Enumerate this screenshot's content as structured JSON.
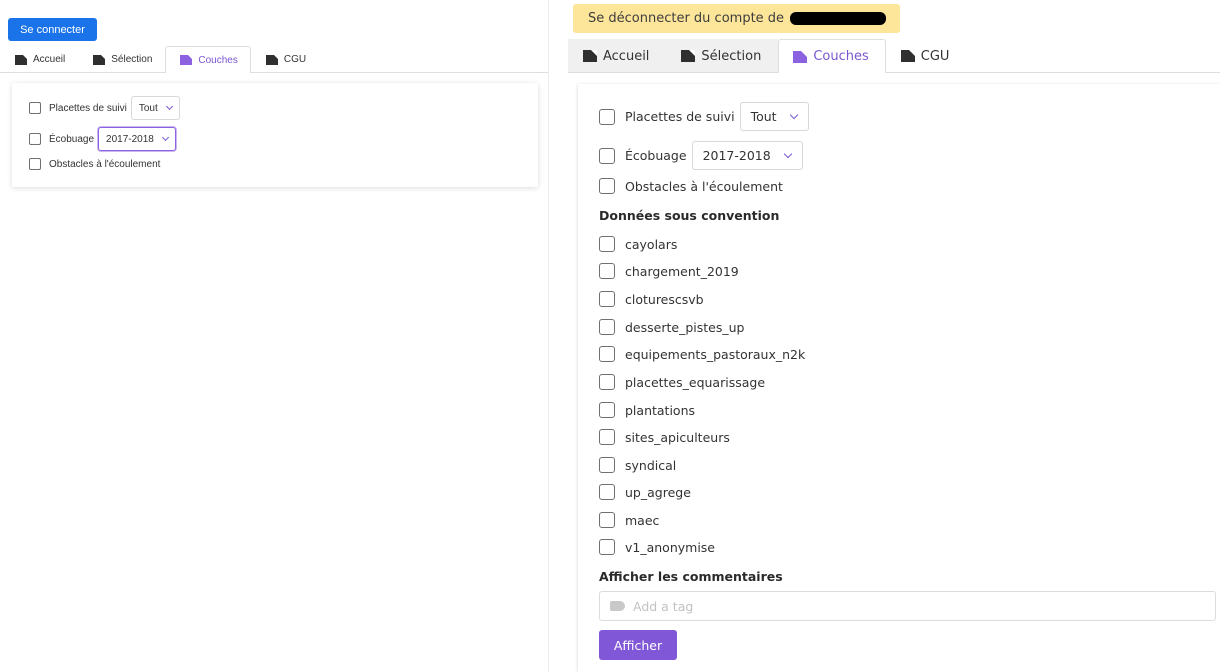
{
  "left": {
    "login_button": "Se connecter",
    "tabs": [
      {
        "label": "Accueil"
      },
      {
        "label": "Sélection"
      },
      {
        "label": "Couches"
      },
      {
        "label": "CGU"
      }
    ],
    "layers": {
      "placettes": {
        "label": "Placettes de suivi",
        "select": "Tout"
      },
      "ecobuage": {
        "label": "Écobuage",
        "select": "2017-2018"
      },
      "obstacles": {
        "label": "Obstacles à l'écoulement"
      }
    }
  },
  "right": {
    "logout_button": "Se déconnecter du compte de",
    "tabs": [
      {
        "label": "Accueil"
      },
      {
        "label": "Sélection"
      },
      {
        "label": "Couches"
      },
      {
        "label": "CGU"
      }
    ],
    "layers": {
      "placettes": {
        "label": "Placettes de suivi",
        "select": "Tout"
      },
      "ecobuage": {
        "label": "Écobuage",
        "select": "2017-2018"
      },
      "obstacles": {
        "label": "Obstacles à l'écoulement"
      }
    },
    "convention_title": "Données sous convention",
    "convention_layers": [
      "cayolars",
      "chargement_2019",
      "cloturescsvb",
      "desserte_pistes_up",
      "equipements_pastoraux_n2k",
      "placettes_equarissage",
      "plantations",
      "sites_apiculteurs",
      "syndical",
      "up_agrege",
      "maec",
      "v1_anonymise"
    ],
    "comments_title": "Afficher les commentaires",
    "tag_placeholder": "Add a tag",
    "show_button": "Afficher"
  },
  "colors": {
    "login_blue": "#1a73e8",
    "logout_yellow": "#fde69a",
    "accent_purple": "#7a57d1",
    "button_purple": "#8057d6"
  },
  "icons": {
    "tab": "document-icon",
    "select": "chevron-down-icon",
    "tag": "tag-icon"
  }
}
